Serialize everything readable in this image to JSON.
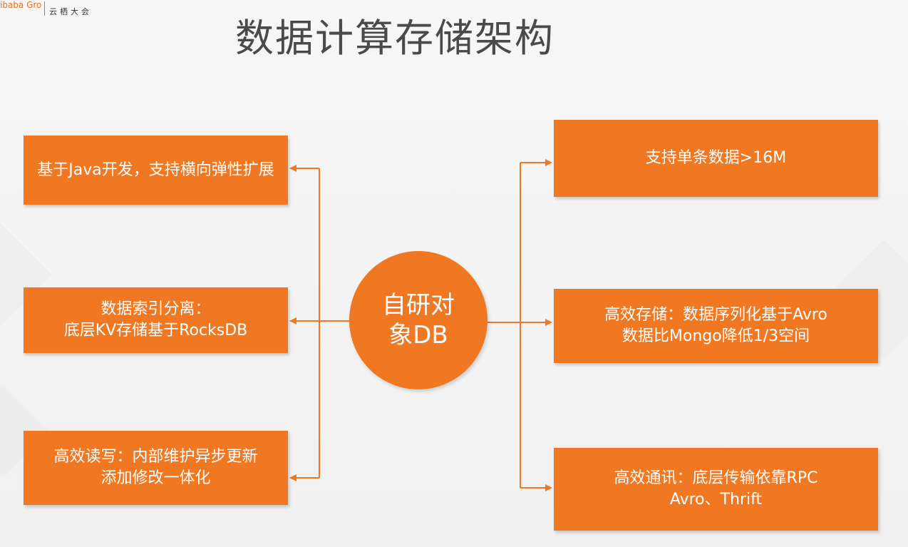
{
  "header": {
    "logo_group": "ibaba Group",
    "logo_yunqi": "云栖大会"
  },
  "title": "数据计算存储架构",
  "center": {
    "line1": "自研对",
    "line2": "象DB"
  },
  "left_boxes": [
    {
      "lines": [
        "基于Java开发，支持横向弹性扩展"
      ]
    },
    {
      "lines": [
        "数据索引分离：",
        "底层KV存储基于RocksDB"
      ]
    },
    {
      "lines": [
        "高效读写：内部维护异步更新",
        "添加修改一体化"
      ]
    }
  ],
  "right_boxes": [
    {
      "lines": [
        "支持单条数据>16M"
      ]
    },
    {
      "lines": [
        "高效存储：数据序列化基于Avro",
        "数据比Mongo降低1/3空间"
      ]
    },
    {
      "lines": [
        "高效通讯：底层传输依靠RPC",
        "Avro、Thrift"
      ]
    }
  ],
  "colors": {
    "accent": "#f07822",
    "title": "#4a4a4a"
  }
}
